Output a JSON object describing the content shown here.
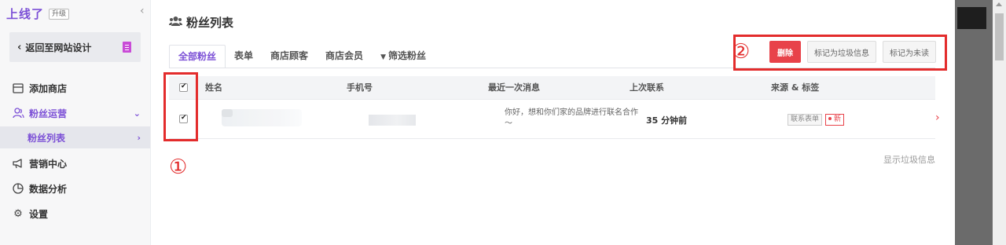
{
  "brand": {
    "logo": "上线了",
    "badge": "升级"
  },
  "sidebar": {
    "back_label": "返回至网站设计",
    "items": [
      {
        "label": "添加商店",
        "icon": "store-icon"
      },
      {
        "label": "粉丝运营",
        "icon": "users-icon"
      },
      {
        "label": "粉丝列表"
      },
      {
        "label": "营销中心",
        "icon": "megaphone-icon"
      },
      {
        "label": "数据分析",
        "icon": "pie-chart-icon"
      },
      {
        "label": "设置",
        "icon": "gear-icon"
      }
    ]
  },
  "page": {
    "title": "粉丝列表"
  },
  "tabs": [
    {
      "label": "全部粉丝",
      "active": true
    },
    {
      "label": "表单"
    },
    {
      "label": "商店顾客"
    },
    {
      "label": "商店会员"
    },
    {
      "label": "筛选粉丝"
    }
  ],
  "actions": {
    "delete": "删除",
    "mark_spam": "标记为垃圾信息",
    "mark_unread": "标记为未读"
  },
  "annotations": {
    "one": "①",
    "two": "②"
  },
  "table": {
    "headers": {
      "name": "姓名",
      "phone": "手机号",
      "last_message": "最近一次消息",
      "last_contact": "上次联系",
      "source": "来源 & 标签"
    },
    "rows": [
      {
        "message": "你好，想和你们家的品牌进行联名合作～",
        "last_contact": "35 分钟前",
        "source_tag": "联系表单",
        "new_tag": "新"
      }
    ]
  },
  "footer": {
    "show_spam": "显示垃圾信息"
  },
  "colors": {
    "accent": "#7b4fd6",
    "danger": "#e8424a",
    "annotation": "#e32c2c"
  }
}
